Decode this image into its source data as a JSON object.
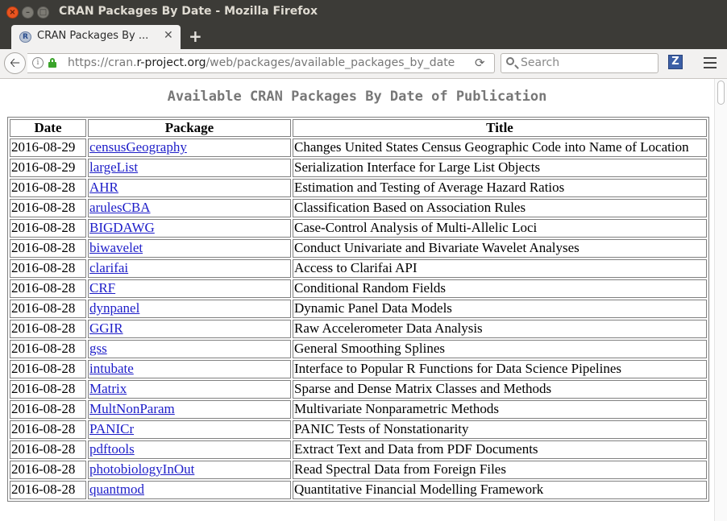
{
  "window": {
    "title": "CRAN Packages By Date - Mozilla Firefox"
  },
  "tab": {
    "title": "CRAN Packages By ...",
    "favicon": "R"
  },
  "urlbar": {
    "prefix": "https://cran.",
    "domain": "r-project.org",
    "path": "/web/packages/available_packages_by_date"
  },
  "search": {
    "placeholder": "Search"
  },
  "toolbar": {
    "zotero_label": "Z"
  },
  "page": {
    "heading": "Available CRAN Packages By Date of Publication",
    "columns": [
      "Date",
      "Package",
      "Title"
    ],
    "rows": [
      {
        "date": "2016-08-29",
        "package": "censusGeography",
        "title": "Changes United States Census Geographic Code into Name of Location"
      },
      {
        "date": "2016-08-29",
        "package": "largeList",
        "title": "Serialization Interface for Large List Objects"
      },
      {
        "date": "2016-08-28",
        "package": "AHR",
        "title": "Estimation and Testing of Average Hazard Ratios"
      },
      {
        "date": "2016-08-28",
        "package": "arulesCBA",
        "title": "Classification Based on Association Rules"
      },
      {
        "date": "2016-08-28",
        "package": "BIGDAWG",
        "title": "Case-Control Analysis of Multi-Allelic Loci"
      },
      {
        "date": "2016-08-28",
        "package": "biwavelet",
        "title": "Conduct Univariate and Bivariate Wavelet Analyses"
      },
      {
        "date": "2016-08-28",
        "package": "clarifai",
        "title": "Access to Clarifai API"
      },
      {
        "date": "2016-08-28",
        "package": "CRF",
        "title": "Conditional Random Fields"
      },
      {
        "date": "2016-08-28",
        "package": "dynpanel",
        "title": "Dynamic Panel Data Models"
      },
      {
        "date": "2016-08-28",
        "package": "GGIR",
        "title": "Raw Accelerometer Data Analysis"
      },
      {
        "date": "2016-08-28",
        "package": "gss",
        "title": "General Smoothing Splines"
      },
      {
        "date": "2016-08-28",
        "package": "intubate",
        "title": "Interface to Popular R Functions for Data Science Pipelines"
      },
      {
        "date": "2016-08-28",
        "package": "Matrix",
        "title": "Sparse and Dense Matrix Classes and Methods"
      },
      {
        "date": "2016-08-28",
        "package": "MultNonParam",
        "title": "Multivariate Nonparametric Methods"
      },
      {
        "date": "2016-08-28",
        "package": "PANICr",
        "title": "PANIC Tests of Nonstationarity"
      },
      {
        "date": "2016-08-28",
        "package": "pdftools",
        "title": "Extract Text and Data from PDF Documents"
      },
      {
        "date": "2016-08-28",
        "package": "photobiologyInOut",
        "title": "Read Spectral Data from Foreign Files"
      },
      {
        "date": "2016-08-28",
        "package": "quantmod",
        "title": "Quantitative Financial Modelling Framework"
      }
    ]
  }
}
